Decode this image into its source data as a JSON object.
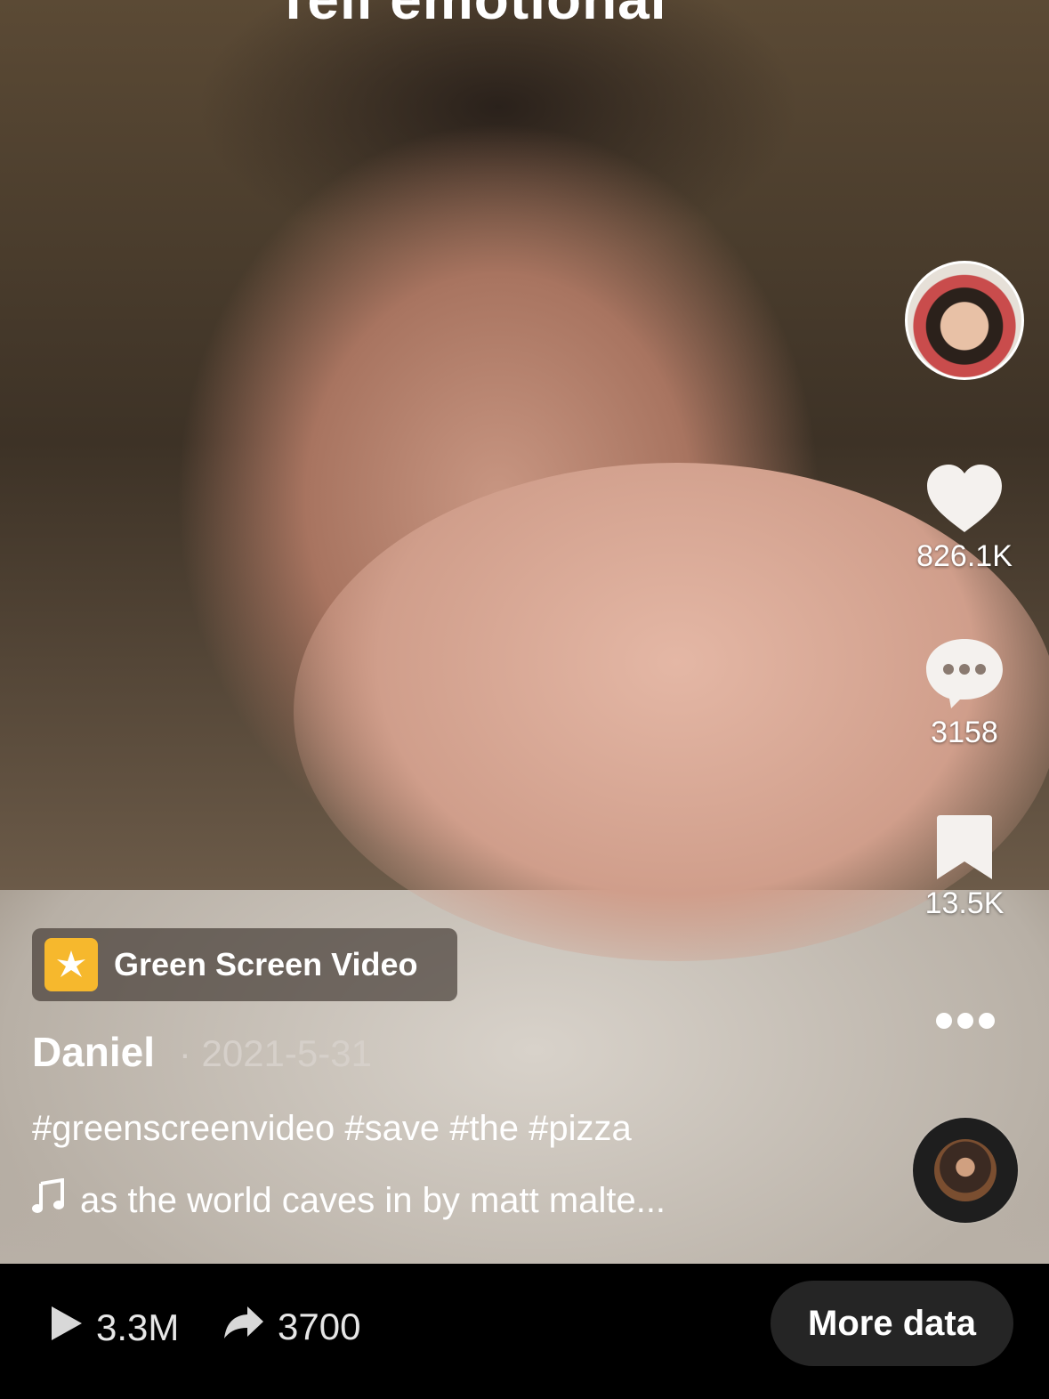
{
  "video": {
    "overlay_text": "Tell emotional"
  },
  "creator": {
    "avatar_alt": "creator avatar"
  },
  "actions": {
    "likes": "826.1K",
    "comments": "3158",
    "saves": "13.5K"
  },
  "effect": {
    "label": "Green Screen Video"
  },
  "post": {
    "username": "Daniel",
    "date": "· 2021-5-31",
    "caption": "#greenscreenvideo #save #the #pizza",
    "sound": "as the world caves in by matt malte..."
  },
  "stats": {
    "plays": "3.3M",
    "shares": "3700"
  },
  "buttons": {
    "more_data": "More data"
  },
  "icons": {
    "heart": "heart-icon",
    "comment": "comment-icon",
    "bookmark": "bookmark-icon",
    "more": "more-icon",
    "music_note": "music-note-icon",
    "play": "play-icon",
    "share": "share-icon"
  }
}
